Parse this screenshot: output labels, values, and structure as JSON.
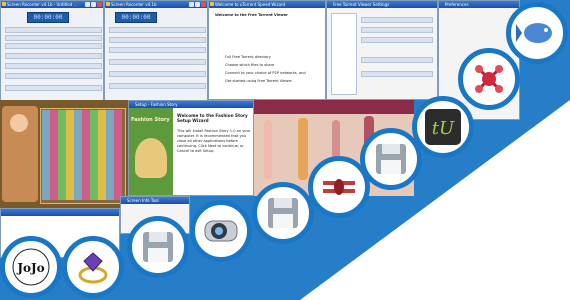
{
  "windows": {
    "recorder_a": {
      "title": "Screen Recorder v4.1b - Untitled ...",
      "counter": "00:00:00"
    },
    "recorder_b": {
      "title": "Screen Recorder v4.1b",
      "counter": "00:00:00"
    },
    "torrent_wizard": {
      "title": "Welcome to uTorrent Speed Wizard",
      "heading": "Welcome to the Free Torrent Viewer",
      "options": [
        "Full Free Torrent directory",
        "Choose which files to share",
        "Connect to your choice of P2P networks, and",
        "Get started using Free Torrent Viewer"
      ]
    },
    "settings_a": {
      "title": "Free Torrent Viewer Settings"
    },
    "settings_b": {
      "title": "Preferences"
    },
    "fashion_setup": {
      "window_title": "Setup - Fashion Story",
      "heading": "Welcome to the Fashion Story Setup Wizard",
      "body": "This will install Fashion Story 1.0 on your computer. It is recommended that you close all other applications before continuing. Click Next to continue, or Cancel to exit Setup.",
      "splash": "Fashion Story"
    },
    "screen_info": {
      "title": "Screen Info Tool"
    }
  },
  "app_icons": [
    {
      "name": "jojo-logo-icon",
      "text": "JoJo"
    },
    {
      "name": "gem-ring-icon"
    },
    {
      "name": "floppy-disk-icon"
    },
    {
      "name": "webcam-icon"
    },
    {
      "name": "floppy-disk-icon"
    },
    {
      "name": "biplane-icon"
    },
    {
      "name": "floppy-disk-icon"
    },
    {
      "name": "tu-logo-icon",
      "text": "tU"
    },
    {
      "name": "molecule-icon"
    },
    {
      "name": "fish-icon"
    }
  ],
  "colors": {
    "band": "#1a77c6",
    "accent": "#1e5da9"
  }
}
